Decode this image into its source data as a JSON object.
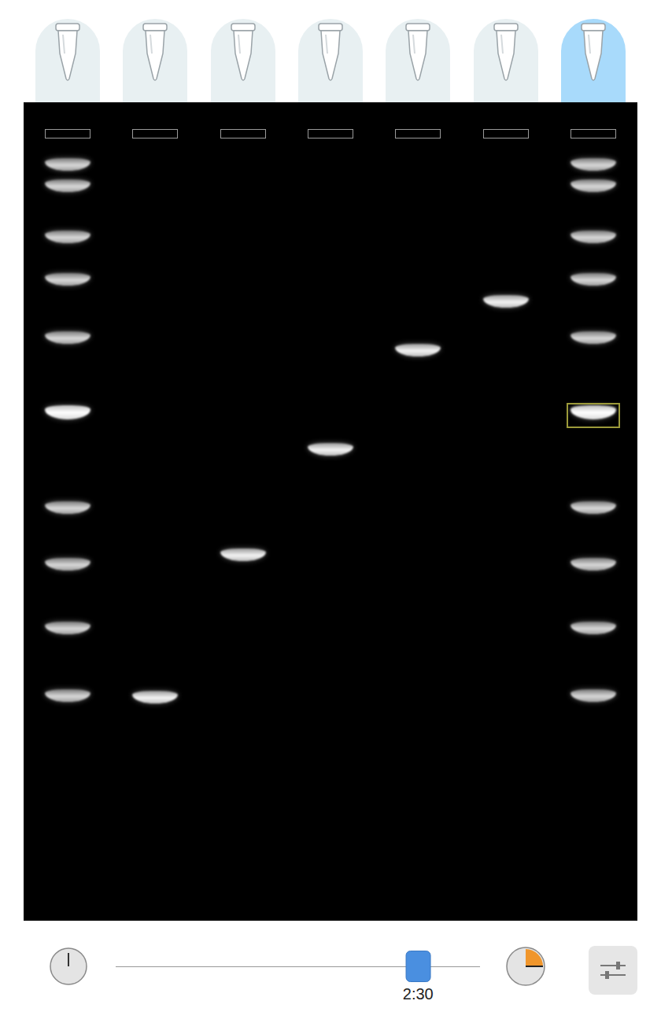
{
  "lanes": [
    {
      "kind": "ladder",
      "selected": false,
      "bands": [
        {
          "position": 0.077,
          "bright": false,
          "highlighted": false
        },
        {
          "position": 0.103,
          "bright": false,
          "highlighted": false
        },
        {
          "position": 0.165,
          "bright": false,
          "highlighted": false
        },
        {
          "position": 0.217,
          "bright": false,
          "highlighted": false
        },
        {
          "position": 0.288,
          "bright": false,
          "highlighted": false
        },
        {
          "position": 0.379,
          "bright": true,
          "highlighted": false
        },
        {
          "position": 0.496,
          "bright": false,
          "highlighted": false
        },
        {
          "position": 0.565,
          "bright": false,
          "highlighted": false
        },
        {
          "position": 0.643,
          "bright": false,
          "highlighted": false
        },
        {
          "position": 0.726,
          "bright": false,
          "highlighted": false
        }
      ]
    },
    {
      "kind": "sample",
      "selected": false,
      "bands": [
        {
          "position": 0.728,
          "bright": false,
          "highlighted": false
        }
      ]
    },
    {
      "kind": "sample",
      "selected": false,
      "bands": [
        {
          "position": 0.554,
          "bright": false,
          "highlighted": false
        }
      ]
    },
    {
      "kind": "sample",
      "selected": false,
      "bands": [
        {
          "position": 0.425,
          "bright": false,
          "highlighted": false
        }
      ]
    },
    {
      "kind": "sample",
      "selected": false,
      "bands": [
        {
          "position": 0.304,
          "bright": false,
          "highlighted": false
        }
      ]
    },
    {
      "kind": "sample",
      "selected": false,
      "bands": [
        {
          "position": 0.244,
          "bright": false,
          "highlighted": false
        }
      ]
    },
    {
      "kind": "ladder",
      "selected": true,
      "bands": [
        {
          "position": 0.077,
          "bright": false,
          "highlighted": false
        },
        {
          "position": 0.103,
          "bright": false,
          "highlighted": false
        },
        {
          "position": 0.165,
          "bright": false,
          "highlighted": false
        },
        {
          "position": 0.217,
          "bright": false,
          "highlighted": false
        },
        {
          "position": 0.288,
          "bright": false,
          "highlighted": false
        },
        {
          "position": 0.379,
          "bright": true,
          "highlighted": true
        },
        {
          "position": 0.496,
          "bright": false,
          "highlighted": false
        },
        {
          "position": 0.565,
          "bright": false,
          "highlighted": false
        },
        {
          "position": 0.643,
          "bright": false,
          "highlighted": false
        },
        {
          "position": 0.726,
          "bright": false,
          "highlighted": false
        }
      ]
    }
  ],
  "time_slider": {
    "level": 0.83,
    "time": "2:30"
  }
}
